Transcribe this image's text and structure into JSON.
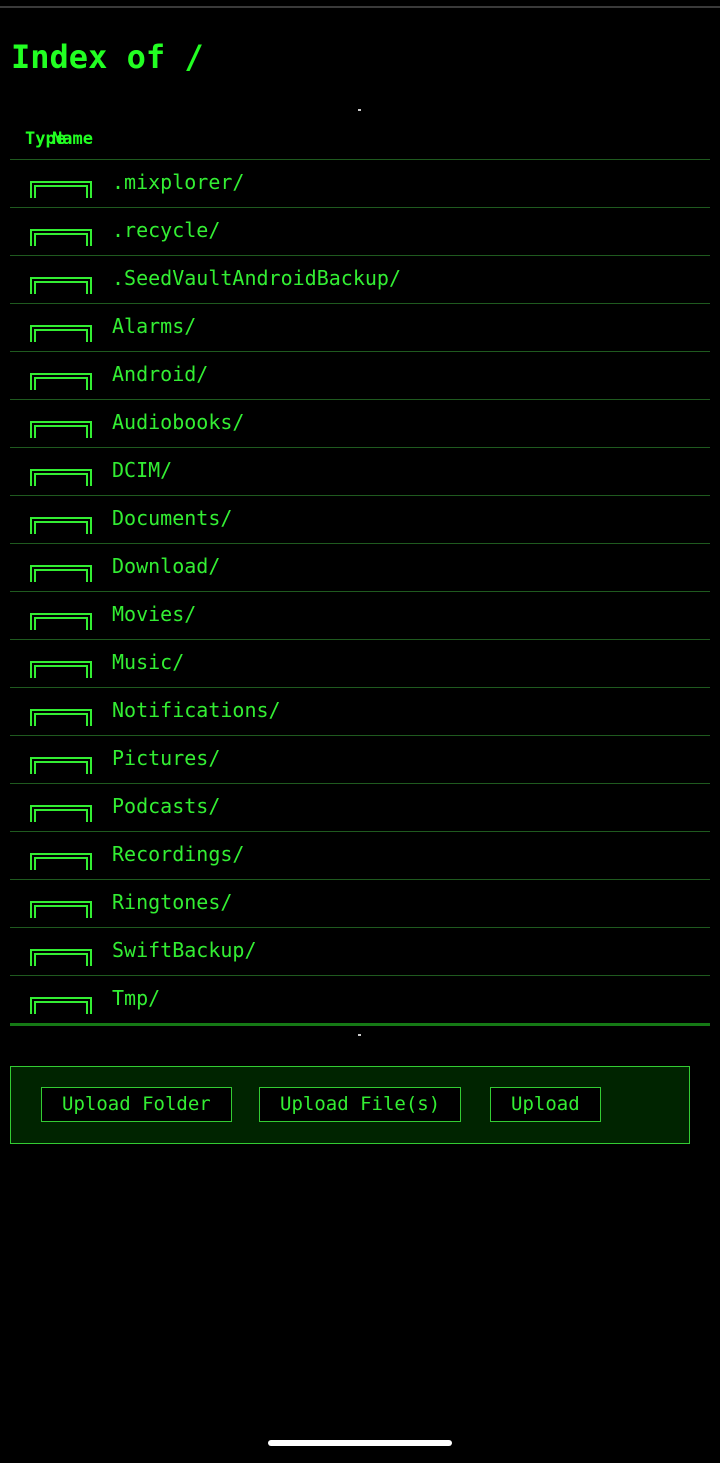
{
  "page": {
    "title": "Index of /"
  },
  "table": {
    "headers": {
      "type": "Type",
      "name": "Name"
    },
    "rows": [
      {
        "name": ".mixplorer/",
        "icon": "folder-icon"
      },
      {
        "name": ".recycle/",
        "icon": "folder-icon"
      },
      {
        "name": ".SeedVaultAndroidBackup/",
        "icon": "folder-icon"
      },
      {
        "name": "Alarms/",
        "icon": "folder-icon"
      },
      {
        "name": "Android/",
        "icon": "folder-icon"
      },
      {
        "name": "Audiobooks/",
        "icon": "folder-icon"
      },
      {
        "name": "DCIM/",
        "icon": "folder-icon"
      },
      {
        "name": "Documents/",
        "icon": "folder-icon"
      },
      {
        "name": "Download/",
        "icon": "folder-icon"
      },
      {
        "name": "Movies/",
        "icon": "folder-icon"
      },
      {
        "name": "Music/",
        "icon": "folder-icon"
      },
      {
        "name": "Notifications/",
        "icon": "folder-icon"
      },
      {
        "name": "Pictures/",
        "icon": "folder-icon"
      },
      {
        "name": "Podcasts/",
        "icon": "folder-icon"
      },
      {
        "name": "Recordings/",
        "icon": "folder-icon"
      },
      {
        "name": "Ringtones/",
        "icon": "folder-icon"
      },
      {
        "name": "SwiftBackup/",
        "icon": "folder-icon"
      },
      {
        "name": "Tmp/",
        "icon": "folder-icon"
      }
    ]
  },
  "upload": {
    "folder_label": "Upload Folder",
    "files_label": "Upload File(s)",
    "upload_label": "Upload"
  },
  "colors": {
    "background": "#000000",
    "text": "#33ee33",
    "title": "#22ff22",
    "panel": "#002400",
    "divider": "#1f5a1f"
  }
}
